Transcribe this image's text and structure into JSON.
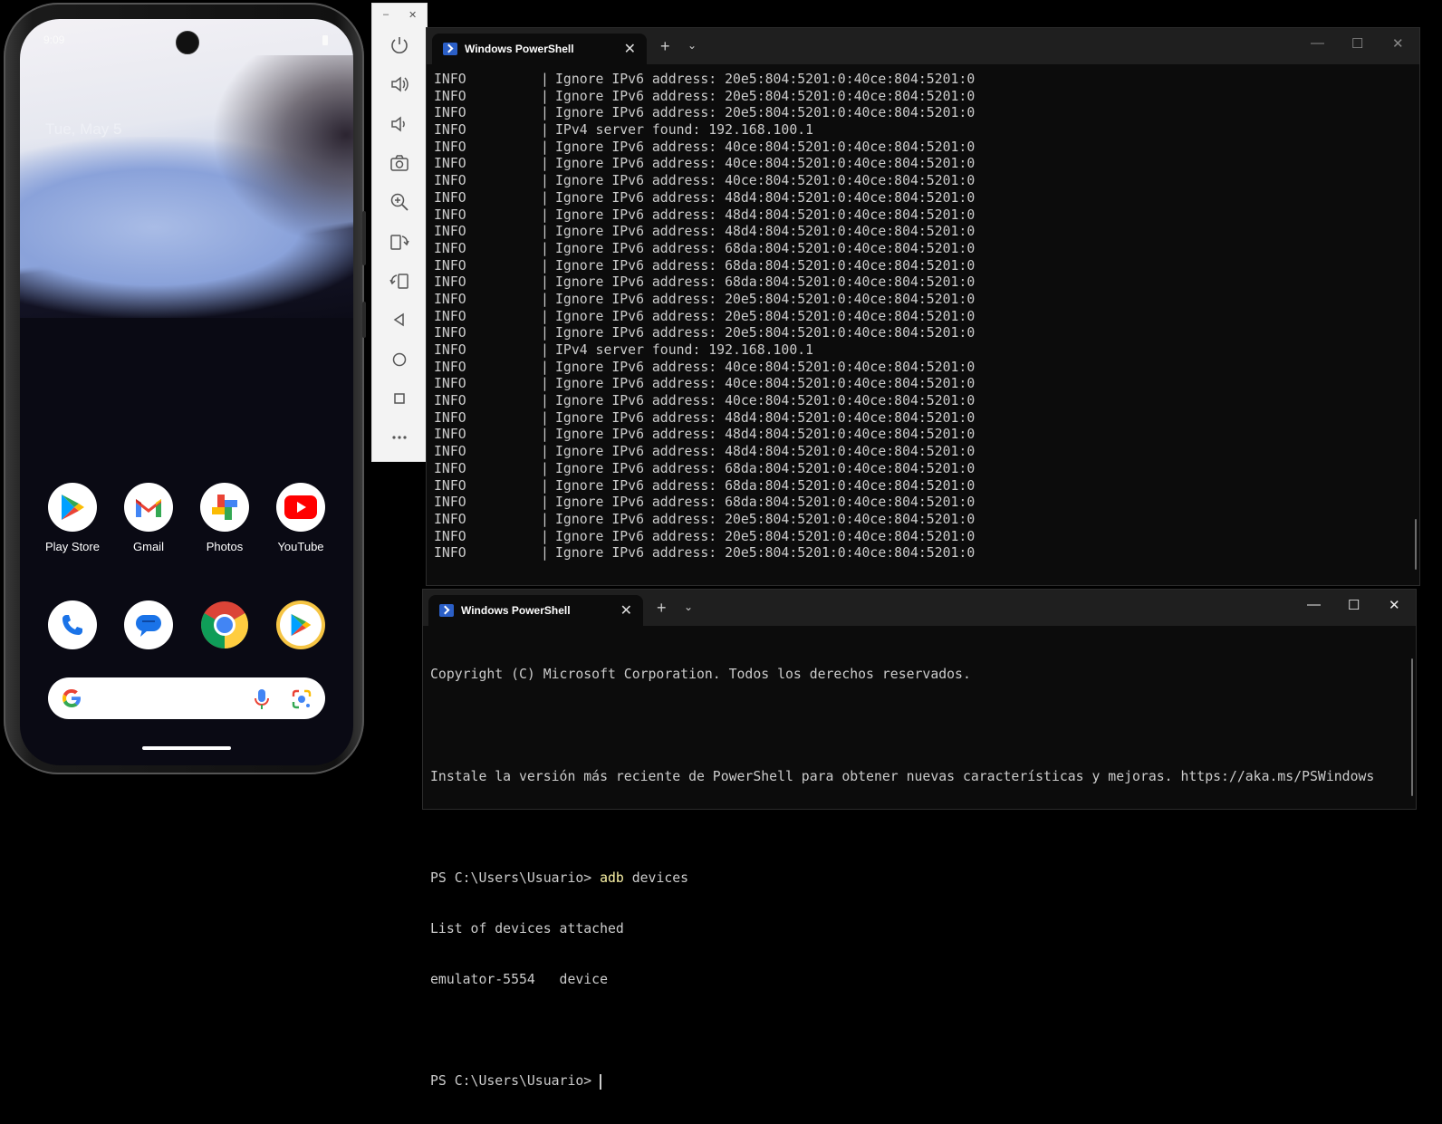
{
  "phone": {
    "status_time": "9:09",
    "date": "Tue, May 5",
    "apps_row1": [
      {
        "label": "Play Store",
        "icon": "play-store-icon"
      },
      {
        "label": "Gmail",
        "icon": "gmail-icon"
      },
      {
        "label": "Photos",
        "icon": "photos-icon"
      },
      {
        "label": "YouTube",
        "icon": "youtube-icon"
      }
    ],
    "dock": [
      {
        "icon": "phone-icon"
      },
      {
        "icon": "messages-icon"
      },
      {
        "icon": "chrome-icon"
      },
      {
        "icon": "play-games-icon"
      }
    ],
    "search_bar": {
      "icon": "google-g-icon",
      "mic": "mic-icon",
      "lens": "lens-icon"
    }
  },
  "emulator_toolbar": {
    "minimize": "–",
    "close": "✕",
    "buttons": [
      "power-icon",
      "volume-up-icon",
      "volume-down-icon",
      "camera-icon",
      "zoom-icon",
      "rotate-left-icon",
      "rotate-right-icon",
      "back-icon",
      "home-icon",
      "overview-icon",
      "more-icon"
    ]
  },
  "terminal_top": {
    "tab_title": "Windows PowerShell",
    "tab_close": "✕",
    "new_tab": "+",
    "dropdown": "⌄",
    "lines": [
      {
        "level": "INFO",
        "msg": "Ignore IPv6 address: 20e5:804:5201:0:40ce:804:5201:0"
      },
      {
        "level": "INFO",
        "msg": "Ignore IPv6 address: 20e5:804:5201:0:40ce:804:5201:0"
      },
      {
        "level": "INFO",
        "msg": "Ignore IPv6 address: 20e5:804:5201:0:40ce:804:5201:0"
      },
      {
        "level": "INFO",
        "msg": "IPv4 server found: 192.168.100.1"
      },
      {
        "level": "INFO",
        "msg": "Ignore IPv6 address: 40ce:804:5201:0:40ce:804:5201:0"
      },
      {
        "level": "INFO",
        "msg": "Ignore IPv6 address: 40ce:804:5201:0:40ce:804:5201:0"
      },
      {
        "level": "INFO",
        "msg": "Ignore IPv6 address: 40ce:804:5201:0:40ce:804:5201:0"
      },
      {
        "level": "INFO",
        "msg": "Ignore IPv6 address: 48d4:804:5201:0:40ce:804:5201:0"
      },
      {
        "level": "INFO",
        "msg": "Ignore IPv6 address: 48d4:804:5201:0:40ce:804:5201:0"
      },
      {
        "level": "INFO",
        "msg": "Ignore IPv6 address: 48d4:804:5201:0:40ce:804:5201:0"
      },
      {
        "level": "INFO",
        "msg": "Ignore IPv6 address: 68da:804:5201:0:40ce:804:5201:0"
      },
      {
        "level": "INFO",
        "msg": "Ignore IPv6 address: 68da:804:5201:0:40ce:804:5201:0"
      },
      {
        "level": "INFO",
        "msg": "Ignore IPv6 address: 68da:804:5201:0:40ce:804:5201:0"
      },
      {
        "level": "INFO",
        "msg": "Ignore IPv6 address: 20e5:804:5201:0:40ce:804:5201:0"
      },
      {
        "level": "INFO",
        "msg": "Ignore IPv6 address: 20e5:804:5201:0:40ce:804:5201:0"
      },
      {
        "level": "INFO",
        "msg": "Ignore IPv6 address: 20e5:804:5201:0:40ce:804:5201:0"
      },
      {
        "level": "INFO",
        "msg": "IPv4 server found: 192.168.100.1"
      },
      {
        "level": "INFO",
        "msg": "Ignore IPv6 address: 40ce:804:5201:0:40ce:804:5201:0"
      },
      {
        "level": "INFO",
        "msg": "Ignore IPv6 address: 40ce:804:5201:0:40ce:804:5201:0"
      },
      {
        "level": "INFO",
        "msg": "Ignore IPv6 address: 40ce:804:5201:0:40ce:804:5201:0"
      },
      {
        "level": "INFO",
        "msg": "Ignore IPv6 address: 48d4:804:5201:0:40ce:804:5201:0"
      },
      {
        "level": "INFO",
        "msg": "Ignore IPv6 address: 48d4:804:5201:0:40ce:804:5201:0"
      },
      {
        "level": "INFO",
        "msg": "Ignore IPv6 address: 48d4:804:5201:0:40ce:804:5201:0"
      },
      {
        "level": "INFO",
        "msg": "Ignore IPv6 address: 68da:804:5201:0:40ce:804:5201:0"
      },
      {
        "level": "INFO",
        "msg": "Ignore IPv6 address: 68da:804:5201:0:40ce:804:5201:0"
      },
      {
        "level": "INFO",
        "msg": "Ignore IPv6 address: 68da:804:5201:0:40ce:804:5201:0"
      },
      {
        "level": "INFO",
        "msg": "Ignore IPv6 address: 20e5:804:5201:0:40ce:804:5201:0"
      },
      {
        "level": "INFO",
        "msg": "Ignore IPv6 address: 20e5:804:5201:0:40ce:804:5201:0"
      },
      {
        "level": "INFO",
        "msg": "Ignore IPv6 address: 20e5:804:5201:0:40ce:804:5201:0"
      }
    ],
    "separator": "|"
  },
  "terminal_bottom": {
    "tab_title": "Windows PowerShell",
    "tab_close": "✕",
    "new_tab": "+",
    "dropdown": "⌄",
    "copyright": "Copyright (C) Microsoft Corporation. Todos los derechos reservados.",
    "install_msg": "Instale la versión más reciente de PowerShell para obtener nuevas características y mejoras. https://aka.ms/PSWindows",
    "prompt1": "PS C:\\Users\\Usuario> ",
    "command": "adb",
    "command_args": " devices",
    "output1": "List of devices attached",
    "output2": "emulator-5554   device",
    "prompt2": "PS C:\\Users\\Usuario> "
  },
  "window_controls": {
    "minimize": "—",
    "maximize": "☐",
    "close": "✕"
  },
  "colors": {
    "terminal_bg": "#0c0c0c",
    "titlebar": "#1f1f1f",
    "command_yellow": "#f9f1a5",
    "ps_blue": "#2b5fc7"
  }
}
